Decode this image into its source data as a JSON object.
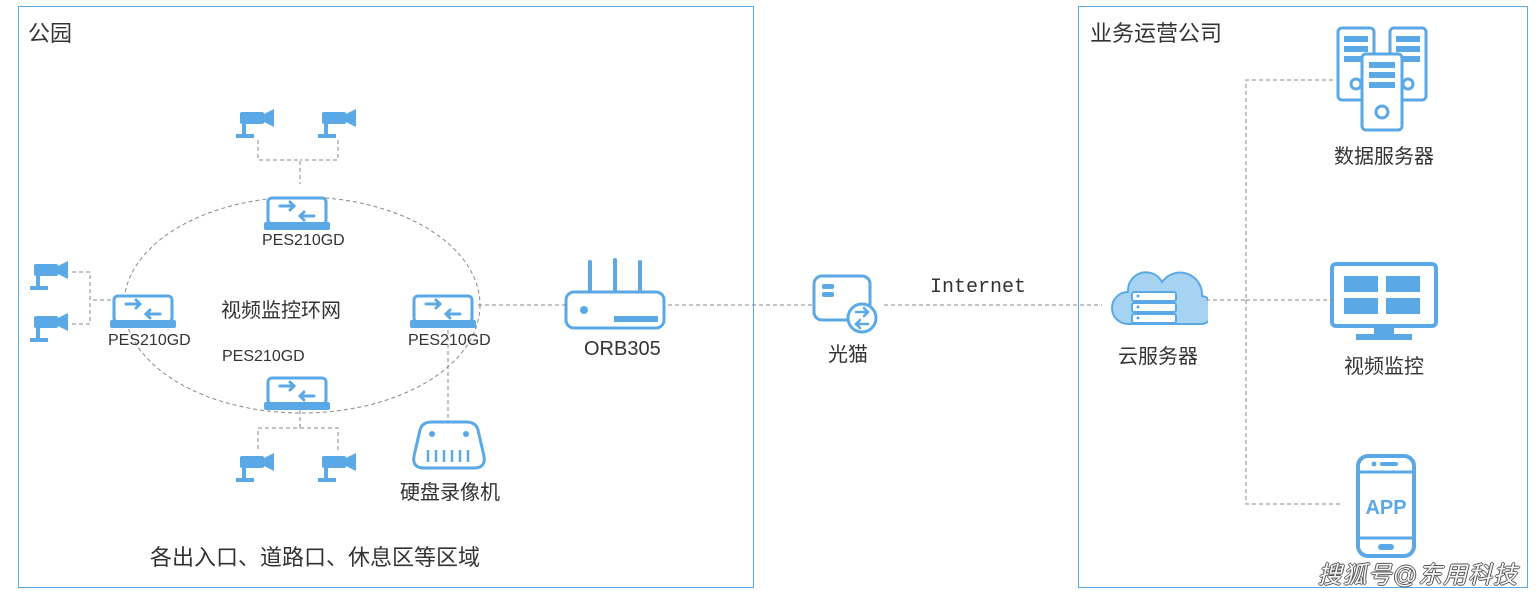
{
  "park": {
    "title": "公园",
    "ring_label": "视频监控环网",
    "footer": "各出入口、道路口、休息区等区域",
    "switches": {
      "top": "PES210GD",
      "left": "PES210GD",
      "right": "PES210GD",
      "bottom": "PES210GD"
    },
    "nvr": "硬盘录像机",
    "router": "ORB305",
    "modem": "光猫"
  },
  "link": "Internet",
  "ops": {
    "title": "业务运营公司",
    "cloud": "云服务器",
    "servers": "数据服务器",
    "monitor": "视频监控",
    "app": "APP"
  },
  "watermark": "搜狐号@东用科技",
  "colors": {
    "blue": "#5aa9e6",
    "lightblue": "#c6e2f7",
    "text": "#333"
  }
}
